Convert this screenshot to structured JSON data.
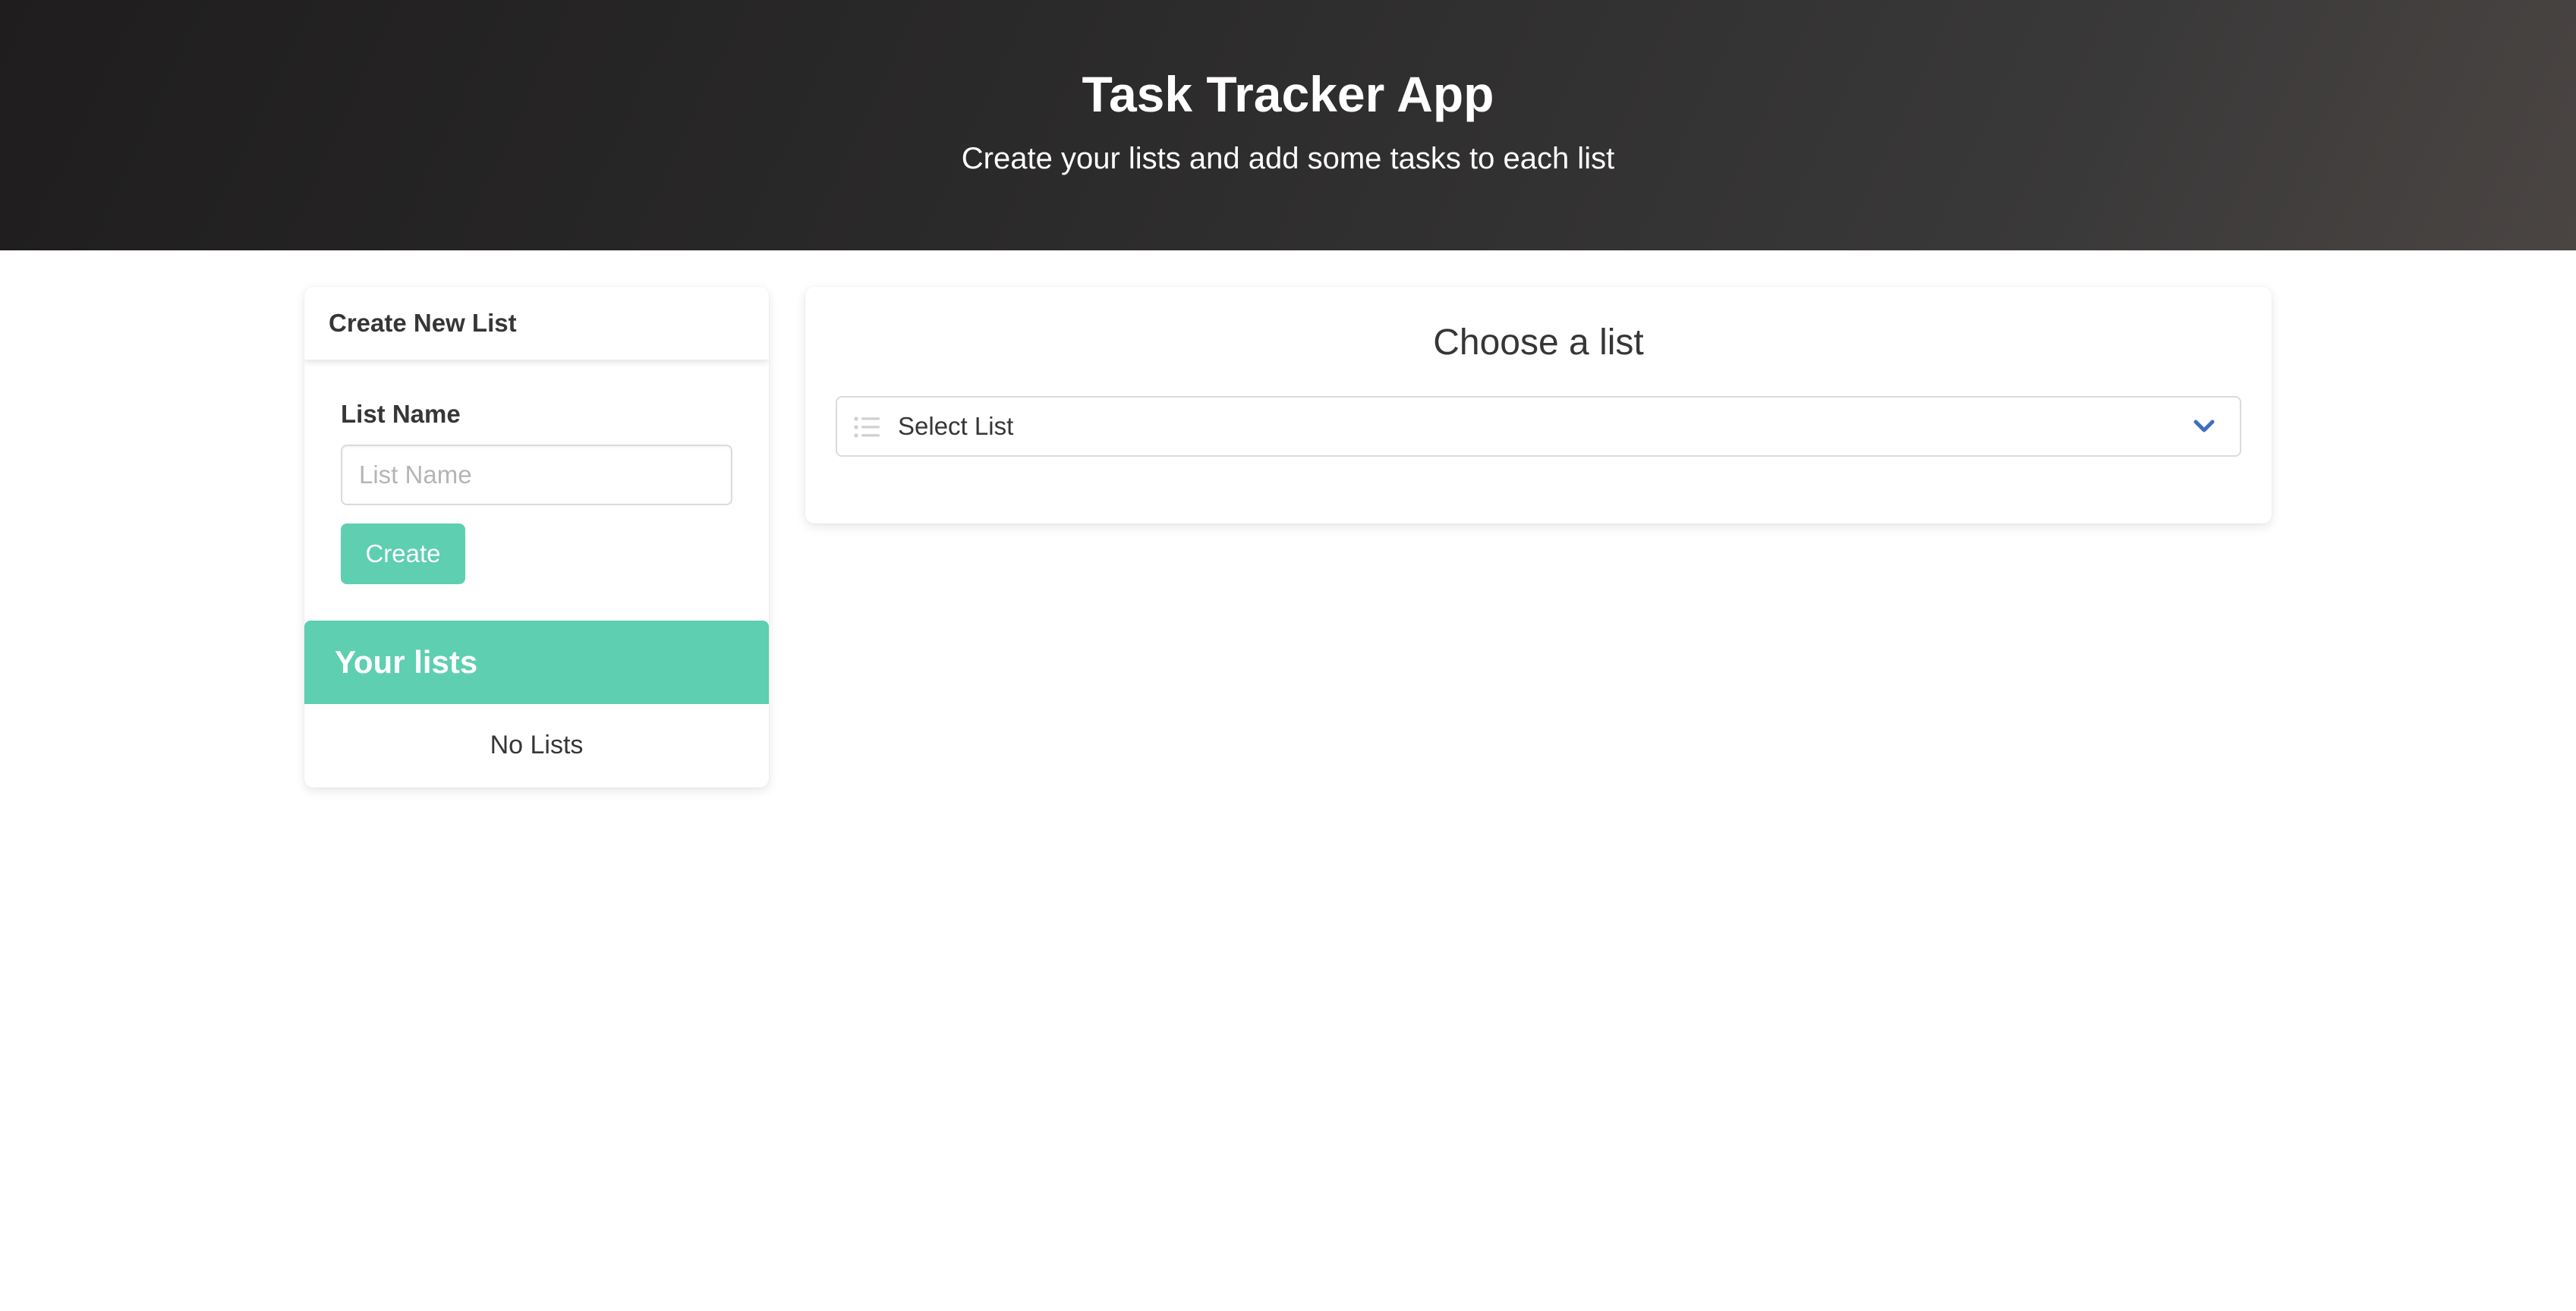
{
  "hero": {
    "title": "Task Tracker App",
    "subtitle": "Create your lists and add some tasks to each list"
  },
  "create_panel": {
    "header": "Create New List",
    "field_label": "List Name",
    "input_placeholder": "List Name",
    "input_value": "",
    "create_button": "Create"
  },
  "lists_panel": {
    "title": "Your lists",
    "empty_text": "No Lists"
  },
  "chooser": {
    "title": "Choose a list",
    "select_value": "Select List",
    "leading_icon": "list-icon",
    "trailing_icon": "chevron-down-icon"
  },
  "colors": {
    "accent": "#5ecfb1",
    "hero_bg": "#2b2a2a",
    "chevron": "#3e6ec0"
  }
}
